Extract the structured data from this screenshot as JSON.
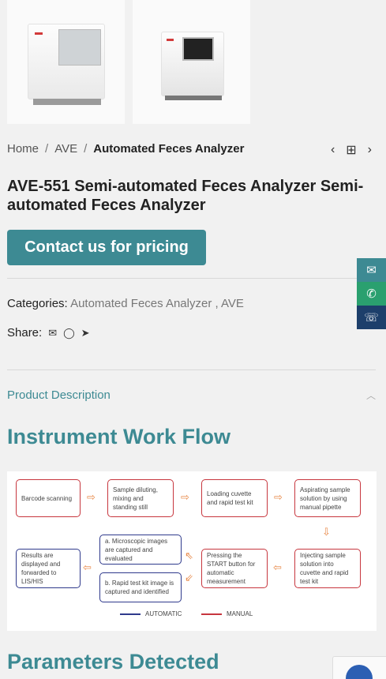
{
  "breadcrumb": {
    "home": "Home",
    "sep": "/",
    "parent": "AVE",
    "current": "Automated Feces Analyzer"
  },
  "nav": {
    "prev": "‹",
    "grid": "⊞",
    "next": "›"
  },
  "product": {
    "title": "AVE-551 Semi-automated Feces Analyzer Semi-automated Feces Analyzer"
  },
  "cta": {
    "label": "Contact us for pricing"
  },
  "meta": {
    "categories_label": "Categories:",
    "categories": "Automated Feces Analyzer , AVE",
    "share_label": "Share:"
  },
  "description": {
    "label": "Product Description"
  },
  "sections": {
    "workflow": "Instrument Work Flow",
    "params": "Parameters Detected"
  },
  "workflow": {
    "barcode": "Barcode scanning",
    "dilute": "Sample diluting, mixing and standing still",
    "load": "Loading cuvette and rapid test kit",
    "aspirate": "Aspirating sample solution by using manual pipette",
    "inject": "Injecting sample solution into cuvette and rapid test kit",
    "press": "Pressing the START button for automatic measurement",
    "micro": "a. Microscopic images are captured and evaluated",
    "rapid": "b. Rapid test kit image is captured and identified",
    "results": "Results are displayed and forwarded to LIS/HIS",
    "legend_auto": "AUTOMATIC",
    "legend_manual": "MANUAL"
  },
  "colors": {
    "accent": "#3d8a93",
    "manual": "#c7363e",
    "automatic": "#2f3a8c",
    "arrow": "#e88a4a"
  }
}
